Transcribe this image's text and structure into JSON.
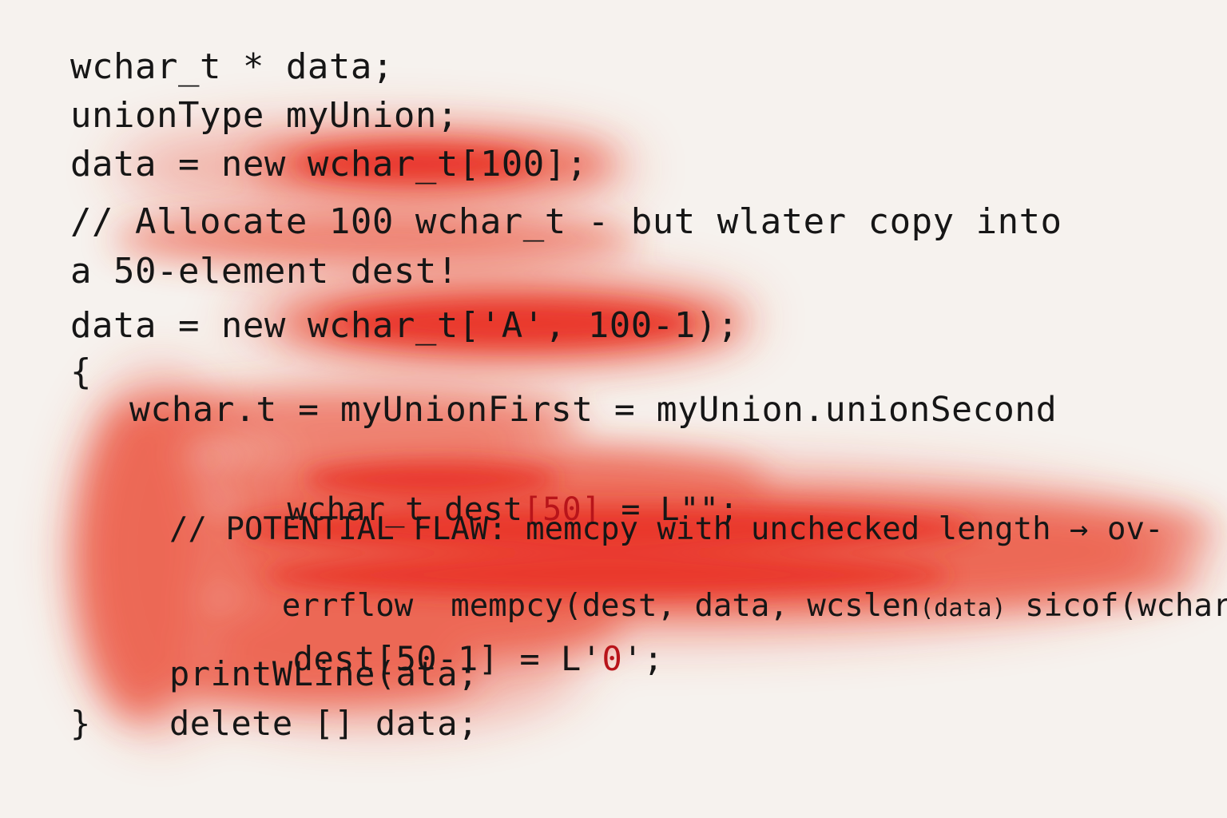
{
  "code_lines": [
    {
      "text": "wchar_t * data;"
    },
    {
      "text": "unionType myUnion;"
    },
    {
      "text": "data = new wchar_t[100];"
    },
    {
      "text": "// Allocate 100 wchar_t - but wlater copy into"
    },
    {
      "text": "a 50-element dest!"
    },
    {
      "text": "data = new wchar_t['A', 100-1);"
    },
    {
      "text": "{"
    },
    {
      "text": "wchar.t = myUnionFirst = myUnion.unionSecond"
    },
    {
      "pre": "wchar_t dest",
      "flag": "[50]",
      "post": " = L\"\";"
    },
    {
      "text": "// POTENTIAL FLAW: memcpy with unchecked length → ov-"
    },
    {
      "pre": "errflow  mempcy(dest, data, wcslen",
      "small": "(data)",
      "post": " sicof(wchar_t)"
    },
    {
      "pre": "dest[50-1] = L'",
      "flag": "0",
      "post": "';"
    },
    {
      "text": "printWLine(ata;"
    },
    {
      "text": "}"
    },
    {
      "text": "delete [] data;"
    }
  ],
  "highlight_color": "#e8331f",
  "flag_text_color": "#b8141a",
  "background_color": "#f6f2ee"
}
